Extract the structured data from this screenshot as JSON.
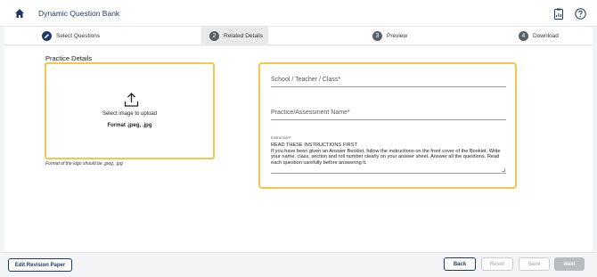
{
  "app": {
    "title": "Dynamic Question Bank"
  },
  "icons": {
    "home": "home-icon",
    "report": "report-icon",
    "help": "help-icon",
    "upload": "upload-icon"
  },
  "stepper": {
    "steps": [
      {
        "number": "",
        "label": "Select Questions",
        "state": "completed"
      },
      {
        "number": "2",
        "label": "Related Details",
        "state": "active"
      },
      {
        "number": "3",
        "label": "Preview",
        "state": "pending"
      },
      {
        "number": "4",
        "label": "Download",
        "state": "pending"
      }
    ]
  },
  "practice": {
    "section_title": "Practice Details",
    "upload_prompt": "Select image to upload",
    "upload_format": "Format .jpeg, .jpg",
    "format_note": "Format of the logo should be .jpeg, .jpg"
  },
  "form": {
    "school_label": "School / Teacher / Class*",
    "assessment_label": "Practice/Assessment Name*",
    "instruction_label": "Instruction*",
    "instruction_text": "READ THESE INSTRUCTIONS FIRST\nIf you have been given an Answer Booklet, follow the instructions on the front cover of the Booklet. Write your name, class, section and roll number clearly on your answer sheet. Answer all the questions. Read each question carefully before answering it."
  },
  "footer": {
    "edit_revision": "Edit Revision Paper",
    "back": "Back",
    "reset": "Reset",
    "save": "Save",
    "next": "Next"
  },
  "colors": {
    "accent": "#1f3a68",
    "highlight": "#f2c94c",
    "disabled": "#b7bcc3"
  }
}
